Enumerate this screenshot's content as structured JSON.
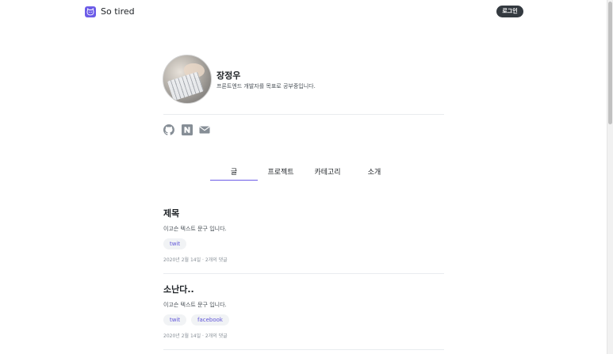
{
  "header": {
    "brand": "So tired",
    "login_label": "로그인"
  },
  "profile": {
    "name": "장정우",
    "bio": "프론트엔드 개발자를 목표로 공부중입니다."
  },
  "social": [
    {
      "icon": "github-icon"
    },
    {
      "icon": "naver-blog-icon"
    },
    {
      "icon": "mail-icon"
    }
  ],
  "tabs": [
    {
      "label": "글",
      "active": true
    },
    {
      "label": "프로젝트",
      "active": false
    },
    {
      "label": "카테고리",
      "active": false
    },
    {
      "label": "소개",
      "active": false
    }
  ],
  "posts": [
    {
      "title": "제목",
      "desc": "이고슨 텍스트 문구 입니다.",
      "tags": [
        "twit"
      ],
      "meta": "2020년 2월 14일 · 2개의 댓글"
    },
    {
      "title": "소난다..",
      "desc": "이고슨 텍스트 문구 입니다.",
      "tags": [
        "twit",
        "facebook"
      ],
      "meta": "2020년 2월 14일 · 2개의 댓글"
    }
  ],
  "colors": {
    "accent": "#6c5ce7",
    "button_dark": "#343a40",
    "tag_bg": "#f1f3f5"
  }
}
